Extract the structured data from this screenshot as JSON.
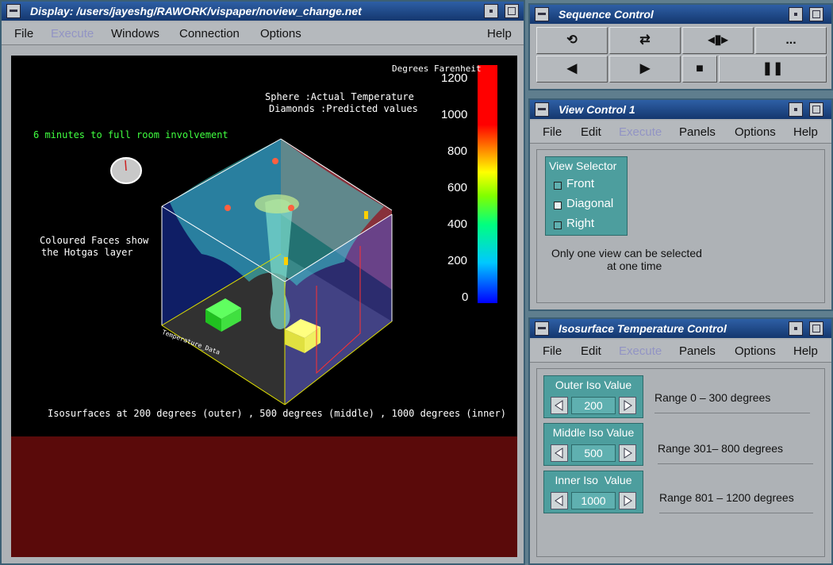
{
  "display": {
    "title": "Display: /users/jayeshg/RAWORK/vispaper/noview_change.net",
    "menu": [
      "File",
      "Execute",
      "Windows",
      "Connection",
      "Options",
      "Help"
    ],
    "scale_title": "Degrees Farenheit",
    "scale_ticks": [
      "1200",
      "1000",
      "800",
      "600",
      "400",
      "200",
      "0"
    ],
    "legend_line1": "Sphere :Actual Temperature",
    "legend_line2": "Diamonds :Predicted values",
    "status": "6 minutes to full room involvement",
    "faces_line1": "Coloured Faces show",
    "faces_line2": "the Hotgas layer",
    "box_label": "Temperature_Data",
    "caption": "Isosurfaces at  200 degrees (outer) , 500 degrees (middle) , 1000 degrees (inner)"
  },
  "sequence": {
    "title": "Sequence Control",
    "buttons": [
      "⟲",
      "⇄",
      "◂▮▸",
      "...",
      "◀",
      "▶",
      "■",
      "❚❚"
    ]
  },
  "view": {
    "title": "View Control 1",
    "menu": [
      "File",
      "Edit",
      "Execute",
      "Panels",
      "Options",
      "Help"
    ],
    "selector_title": "View Selector",
    "options": [
      "Front",
      "Diagonal",
      "Right"
    ],
    "selected": "Diagonal",
    "note_line1": "Only one view  can be selected",
    "note_line2": "at one time"
  },
  "iso": {
    "title": "Isosurface Temperature Control",
    "menu": [
      "File",
      "Edit",
      "Execute",
      "Panels",
      "Options",
      "Help"
    ],
    "controls": [
      {
        "label": "Outer Iso Value",
        "value": "200",
        "range": "Range 0 – 300 degrees"
      },
      {
        "label": "Middle Iso Value",
        "value": "500",
        "range": "Range 301– 800 degrees"
      },
      {
        "label": "Inner Iso  Value",
        "value": "1000",
        "range": "Range 801 – 1200 degrees"
      }
    ]
  },
  "colors": {
    "canvas": "#000000",
    "maroon": "#5a0a0a",
    "teal": "#4d9e9e",
    "window": "#aeb2b6",
    "titlebar": "#14376e"
  }
}
